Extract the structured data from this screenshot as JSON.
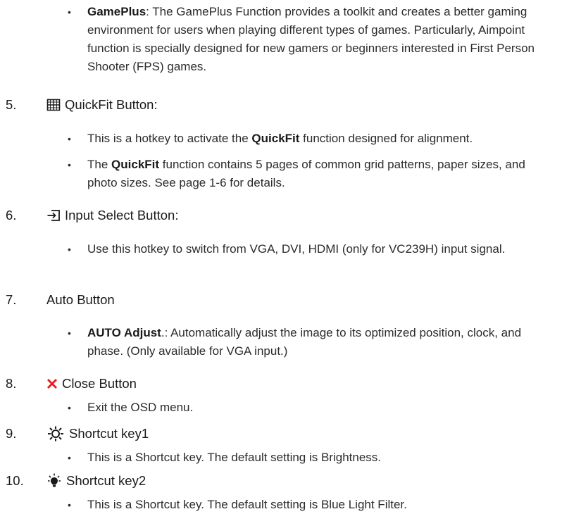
{
  "bullet_char": "•",
  "gameplus": {
    "bold": "GamePlus",
    "rest": ": The GamePlus Function provides a toolkit and creates a better gaming environment for users when playing different types of games. Particularly, Aimpoint function is specially designed for new gamers or beginners interested in First Person Shooter (FPS) games."
  },
  "items": [
    {
      "number": "5.",
      "icon": "quickfit-grid-icon",
      "label": "QuickFit Button:",
      "bullets": [
        {
          "pre": "This is a hotkey to activate the ",
          "bold": "QuickFit",
          "post": " function designed for alignment."
        },
        {
          "pre": "The ",
          "bold": "QuickFit",
          "post": " function contains 5 pages of common grid patterns, paper sizes, and photo sizes. See page 1-6 for details."
        }
      ]
    },
    {
      "number": "6.",
      "icon": "input-select-icon",
      "label": "Input Select Button:",
      "bullets": [
        {
          "text": "Use this hotkey to switch from VGA, DVI, HDMI (only for VC239H) input signal."
        }
      ]
    },
    {
      "number": "7.",
      "label": "Auto Button",
      "bullets": [
        {
          "bold": "AUTO Adjust",
          "post": ".: Automatically adjust the image to its optimized position, clock, and phase. (Only available for VGA input.)"
        }
      ]
    },
    {
      "number": "8.",
      "icon": "close-x-icon",
      "label": "Close Button",
      "bullets": [
        {
          "text": "Exit the OSD menu."
        }
      ]
    },
    {
      "number": "9.",
      "icon": "brightness-sun-icon",
      "label": "Shortcut key1",
      "bullets": [
        {
          "text": "This is a Shortcut key. The default setting is Brightness."
        }
      ]
    },
    {
      "number": "10.",
      "icon": "blue-light-icon",
      "label": "Shortcut key2",
      "bullets": [
        {
          "text": "This is a Shortcut key. The default setting is Blue Light Filter."
        }
      ]
    }
  ],
  "colors": {
    "close_icon": "#e8191c",
    "text": "#1a1a1a"
  }
}
